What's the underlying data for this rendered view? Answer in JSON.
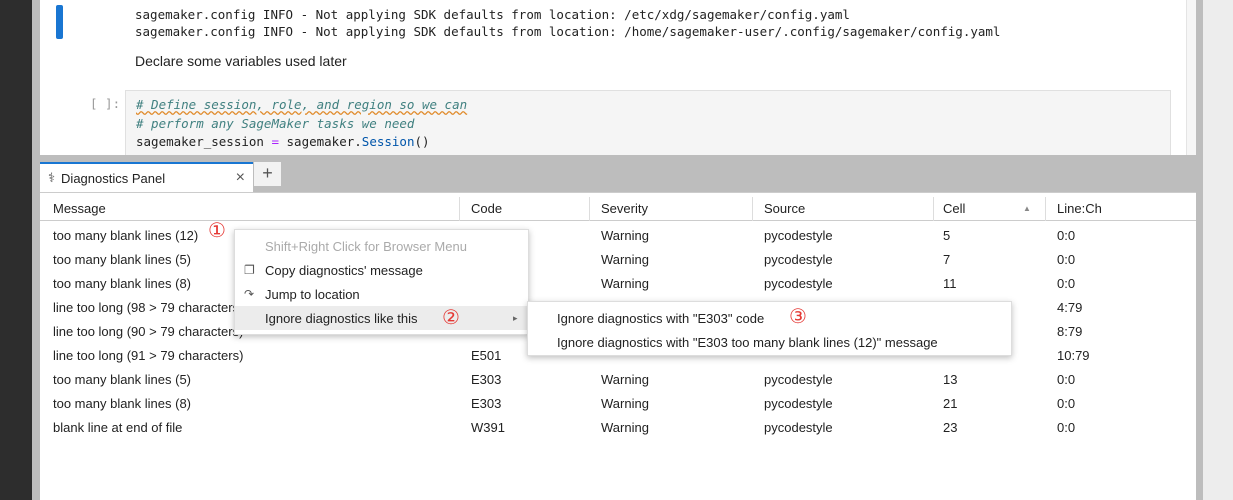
{
  "notebook": {
    "output_lines": [
      "sagemaker.config INFO - Not applying SDK defaults from location: /etc/xdg/sagemaker/config.yaml",
      "sagemaker.config INFO - Not applying SDK defaults from location: /home/sagemaker-user/.config/sagemaker/config.yaml"
    ],
    "markdown": "Declare some variables used later",
    "prompt": "[ ]:",
    "code": {
      "line1": "# Define session, role, and region so we can",
      "line2": "# perform any SageMaker tasks we need",
      "line3_var": "sagemaker_session ",
      "line3_op": "=",
      "line3_obj": " sagemaker.",
      "line3_fn": "Session",
      "line3_end": "()"
    }
  },
  "panel": {
    "tab_label": "Diagnostics Panel",
    "tab_icon": "stethoscope-icon",
    "close": "×",
    "add": "+"
  },
  "table": {
    "headers": [
      "Message",
      "Code",
      "Severity",
      "Source",
      "Cell",
      "Line:Ch"
    ],
    "sort_indicator": "▲",
    "rows": [
      [
        "too many blank lines (12)",
        "",
        "Warning",
        "pycodestyle",
        "5",
        "0:0"
      ],
      [
        "too many blank lines (5)",
        "",
        "Warning",
        "pycodestyle",
        "7",
        "0:0"
      ],
      [
        "too many blank lines (8)",
        "",
        "Warning",
        "pycodestyle",
        "11",
        "0:0"
      ],
      [
        "line too long (98 > 79 characters)",
        "",
        "",
        "",
        "",
        "4:79"
      ],
      [
        "line too long (90 > 79 characters)",
        "",
        "",
        "",
        "",
        "8:79"
      ],
      [
        "line too long (91 > 79 characters)",
        "E501",
        "",
        "",
        "",
        "10:79"
      ],
      [
        "too many blank lines (5)",
        "E303",
        "Warning",
        "pycodestyle",
        "13",
        "0:0"
      ],
      [
        "too many blank lines (8)",
        "E303",
        "Warning",
        "pycodestyle",
        "21",
        "0:0"
      ],
      [
        "blank line at end of file",
        "W391",
        "Warning",
        "pycodestyle",
        "23",
        "0:0"
      ]
    ]
  },
  "context_menu": {
    "hint": "Shift+Right Click for Browser Menu",
    "copy": "Copy diagnostics' message",
    "jump": "Jump to location",
    "ignore": "Ignore diagnostics like this",
    "submenu_arrow": "▸"
  },
  "submenu": {
    "by_code": "Ignore diagnostics with \"E303\" code",
    "by_message": "Ignore diagnostics with \"E303 too many blank lines (12)\" message"
  },
  "annotations": [
    "①",
    "②",
    "③"
  ],
  "colors": {
    "accent": "#1976d2",
    "annotation": "#e53935"
  }
}
